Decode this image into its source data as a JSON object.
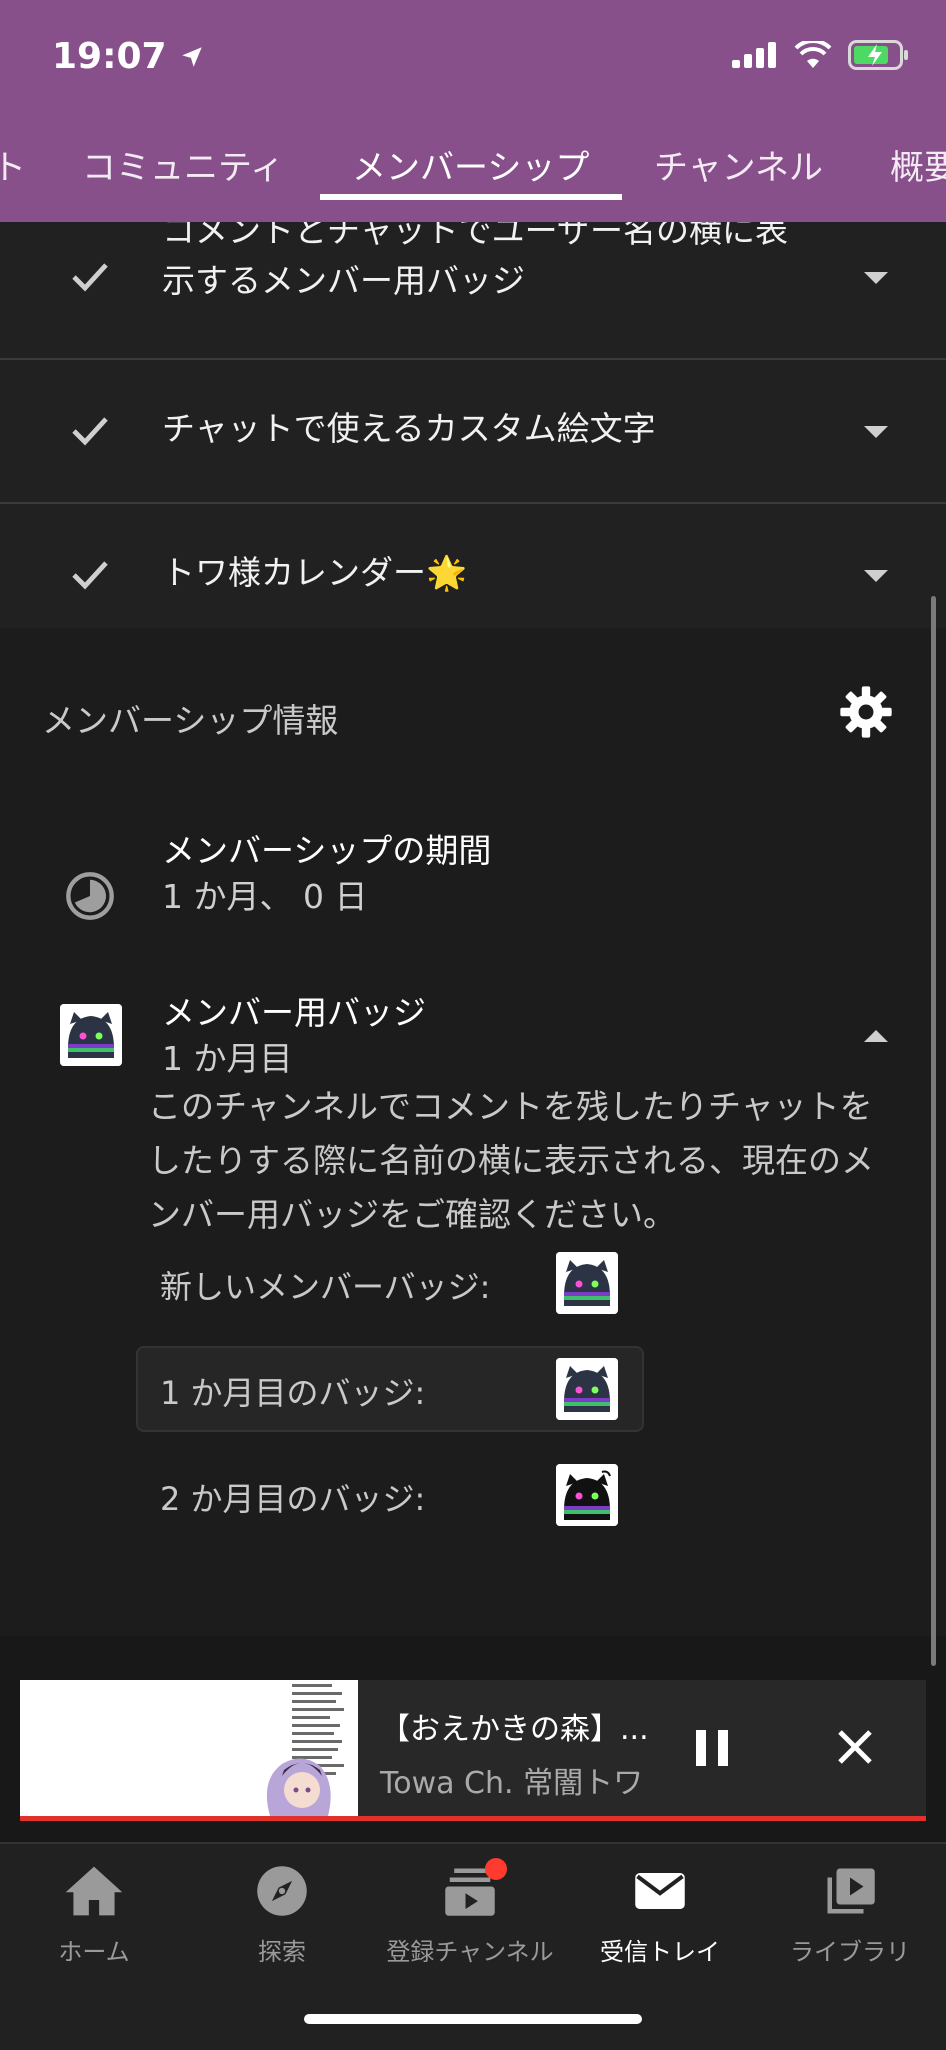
{
  "status_bar": {
    "time": "19:07"
  },
  "tabs": [
    {
      "label": "ト"
    },
    {
      "label": "コミュニティ"
    },
    {
      "label": "メンバーシップ"
    },
    {
      "label": "チャンネル"
    },
    {
      "label": "概要"
    }
  ],
  "perks": [
    {
      "line1": "コメントとチャットでユーザー名の横に表",
      "line2": "示するメンバー用バッジ"
    },
    {
      "label": "チャットで使えるカスタム絵文字"
    },
    {
      "label": "トワ様カレンダー🌟"
    }
  ],
  "membership_info": {
    "title": "メンバーシップ情報",
    "period_title": "メンバーシップの期間",
    "period_value": "1 か月、 0 日",
    "badge_title": "メンバー用バッジ",
    "badge_value": "1 か月目",
    "description": "このチャンネルでコメントを残したりチャットをしたりする際に名前の横に表示される、現在のメンバー用バッジをご確認ください。",
    "badges": [
      {
        "label": "新しいメンバーバッジ:"
      },
      {
        "label": "1 か月目のバッジ:"
      },
      {
        "label": "2 か月目のバッジ:"
      }
    ]
  },
  "mini_player": {
    "title": "【おえかきの森】...",
    "channel": "Towa Ch. 常闇トワ"
  },
  "bottom_nav": [
    {
      "label": "ホーム",
      "icon": "home-icon"
    },
    {
      "label": "探索",
      "icon": "explore-icon"
    },
    {
      "label": "登録チャンネル",
      "icon": "subscriptions-icon"
    },
    {
      "label": "受信トレイ",
      "icon": "inbox-icon"
    },
    {
      "label": "ライブラリ",
      "icon": "library-icon"
    }
  ],
  "colors": {
    "header": "#87508a",
    "progress": "#e0312b",
    "notification": "#ff3b30"
  }
}
